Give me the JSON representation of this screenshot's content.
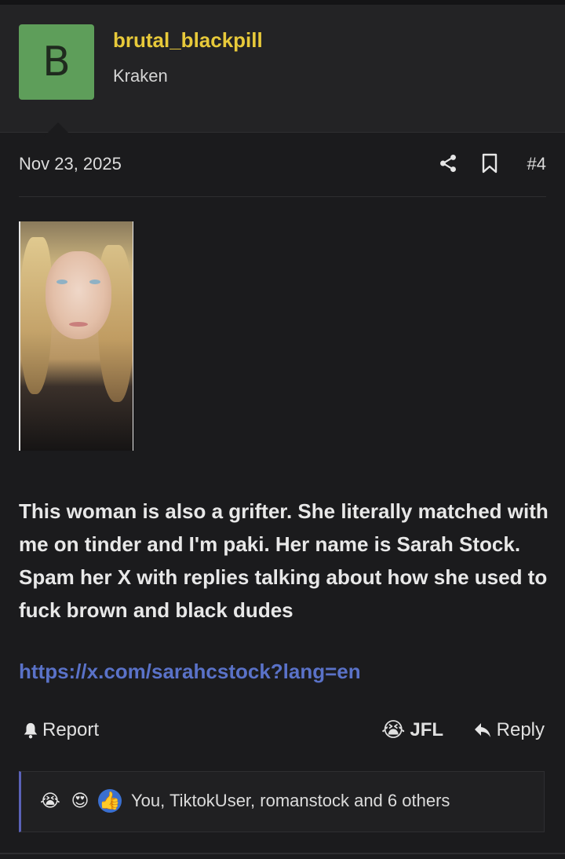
{
  "user": {
    "avatar_letter": "B",
    "username": "brutal_blackpill",
    "title": "Kraken",
    "avatar_color": "#5e9e5a",
    "username_color": "#e7c93a"
  },
  "post": {
    "date": "Nov 23, 2025",
    "number": "#4",
    "share_icon": "share-icon",
    "bookmark_icon": "bookmark-icon",
    "body": "This woman is also a grifter. She literally matched with me on tinder and I'm paki. Her name is Sarah Stock. Spam her X with replies talking about how she used to fuck brown and black dudes",
    "link": "https://x.com/sarahcstock?lang=en",
    "link_color": "#5a72c8"
  },
  "actions": {
    "report_label": "Report",
    "report_icon": "bell-icon",
    "jfl_label": "JFL",
    "jfl_icon": "😭",
    "reply_label": "Reply",
    "reply_icon": "reply-arrow-icon"
  },
  "reactions": {
    "icons": [
      "😭",
      "😍",
      "👍"
    ],
    "summary": "You, TiktokUser, romanstock and 6 others",
    "accent_color": "#5a62b8"
  }
}
